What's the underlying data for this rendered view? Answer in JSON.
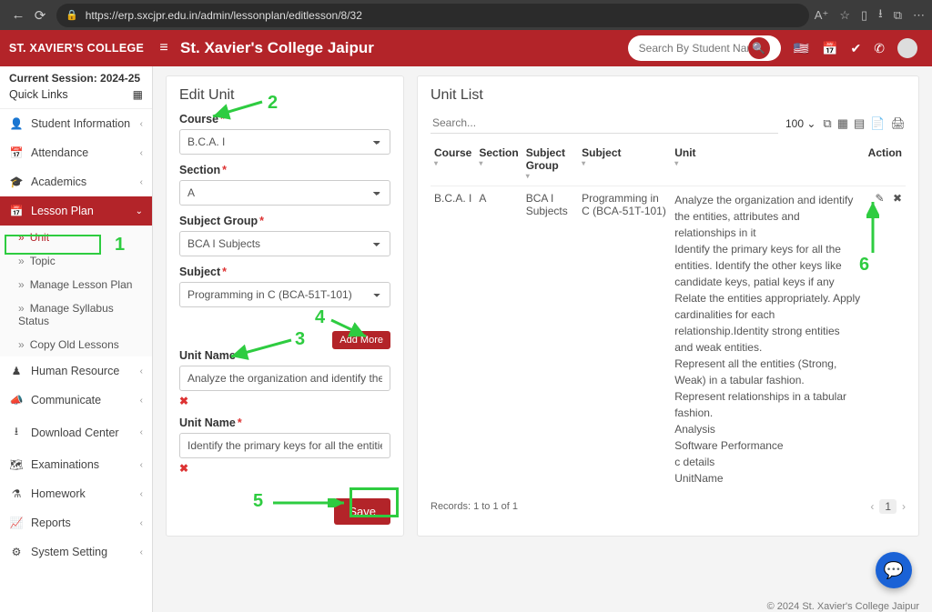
{
  "browser": {
    "url": "https://erp.sxcjpr.edu.in/admin/lessonplan/editlesson/8/32"
  },
  "header": {
    "brand": "ST. XAVIER'S COLLEGE",
    "title": "St. Xavier's College Jaipur",
    "search_placeholder": "Search By Student Name"
  },
  "sidebar": {
    "session": "Current Session: 2024-25",
    "quick": "Quick Links",
    "items": [
      {
        "label": "Student Information"
      },
      {
        "label": "Attendance"
      },
      {
        "label": "Academics"
      },
      {
        "label": "Lesson Plan"
      },
      {
        "label": "Human Resource"
      },
      {
        "label": "Communicate"
      },
      {
        "label": "Download Center"
      },
      {
        "label": "Examinations"
      },
      {
        "label": "Homework"
      },
      {
        "label": "Reports"
      },
      {
        "label": "System Setting"
      }
    ],
    "lesson_sub": [
      {
        "label": "Unit"
      },
      {
        "label": "Topic"
      },
      {
        "label": "Manage Lesson Plan"
      },
      {
        "label": "Manage Syllabus Status"
      },
      {
        "label": "Copy Old Lessons"
      }
    ]
  },
  "edit_unit": {
    "title": "Edit Unit",
    "course_label": "Course",
    "course_value": "B.C.A. I",
    "section_label": "Section",
    "section_value": "A",
    "subject_group_label": "Subject Group",
    "subject_group_value": "BCA I Subjects",
    "subject_label": "Subject",
    "subject_value": "Programming in C (BCA-51T-101)",
    "add_more": "Add More",
    "unit_name_label": "Unit Name",
    "unit_names": [
      "Analyze the organization and identify the entities",
      "Identify the primary keys for all the entities. Iden"
    ],
    "save": "Save"
  },
  "unit_list": {
    "title": "Unit List",
    "search_placeholder": "Search...",
    "per_page": "100",
    "headers": {
      "course": "Course",
      "section": "Section",
      "subject_group": "Subject Group",
      "subject": "Subject",
      "unit": "Unit",
      "action": "Action"
    },
    "rows": [
      {
        "course": "B.C.A. I",
        "section": "A",
        "subject_group": "BCA I Subjects",
        "subject": "Programming in C (BCA-51T-101)",
        "unit": "Analyze the organization and identify the entities, attributes and relationships in it\nIdentify the primary keys for all the entities. Identify the other keys like candidate keys, patial keys if any\nRelate the entities appropriately. Apply cardinalities for each relationship.Identity strong entities and weak entities.\nRepresent all the entities (Strong, Weak) in a tabular fashion.\nRepresent relationships in a tabular fashion.\nAnalysis\nSoftware Performance\nc details\nUnitName"
      }
    ],
    "records": "Records: 1 to 1 of 1"
  },
  "footer": "© 2024 St. Xavier's College Jaipur",
  "annotations": {
    "n1": "1",
    "n2": "2",
    "n3": "3",
    "n4": "4",
    "n5": "5",
    "n6": "6"
  }
}
